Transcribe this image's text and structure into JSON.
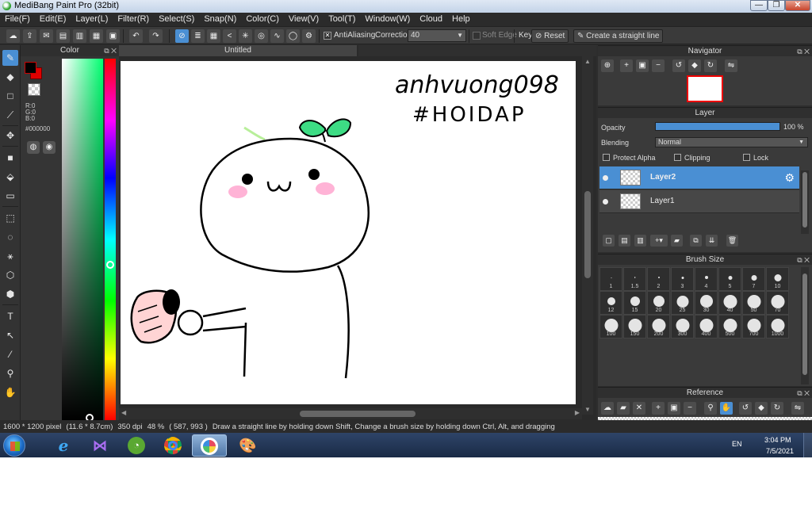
{
  "window": {
    "title": "MediBang Paint Pro (32bit)",
    "minimize_glyph": "—",
    "maximize_glyph": "❐",
    "close_glyph": "✕"
  },
  "menu": [
    "File(F)",
    "Edit(E)",
    "Layer(L)",
    "Filter(R)",
    "Select(S)",
    "Snap(N)",
    "Color(C)",
    "View(V)",
    "Tool(T)",
    "Window(W)",
    "Cloud",
    "Help"
  ],
  "toolbar": {
    "antialiasing_label": "AntiAliasing",
    "correction_label": "Correction",
    "correction_value": "40",
    "soft_edge_label": "Soft Edge",
    "key_label": "Key",
    "reset_label": "Reset",
    "straight_line_label": "Create a straight line",
    "antialiasing_checked": true,
    "soft_edge_checked": false
  },
  "color_panel": {
    "title": "Color",
    "r": "R:0",
    "g": "G:0",
    "b": "B:0",
    "hex": "#000000",
    "foreground_color": "#000000",
    "background_color": "#e00000"
  },
  "document": {
    "tab_title": "Untitled",
    "handwriting_line1": "anhvuong098",
    "handwriting_line2": "#HOIDAP"
  },
  "navigator": {
    "title": "Navigator"
  },
  "layer_panel": {
    "title": "Layer",
    "opacity_label": "Opacity",
    "opacity_value": "100 %",
    "opacity_percent": 100,
    "blending_label": "Blending",
    "blending_value": "Normal",
    "protect_alpha_label": "Protect Alpha",
    "clipping_label": "Clipping",
    "lock_label": "Lock",
    "layers": [
      {
        "name": "Layer2",
        "selected": true
      },
      {
        "name": "Layer1",
        "selected": false
      }
    ]
  },
  "brush_panel": {
    "title": "Brush Size",
    "sizes": [
      "1",
      "1.5",
      "2",
      "3",
      "4",
      "5",
      "7",
      "10",
      "12",
      "15",
      "20",
      "25",
      "30",
      "40",
      "50",
      "70",
      "100",
      "150",
      "200",
      "300",
      "400",
      "500",
      "700",
      "1000"
    ]
  },
  "reference_panel": {
    "title": "Reference"
  },
  "status": {
    "pixel_size": "1600 * 1200 pixel",
    "cm_size": "(11.6 * 8.7cm)",
    "dpi": "350 dpi",
    "zoom": "48 %",
    "cursor": "( 587, 993 )",
    "hint": "Draw a straight line by holding down Shift, Change a brush size by holding down Ctrl, Alt, and dragging"
  },
  "taskbar": {
    "language": "EN",
    "time": "3:04 PM",
    "date": "7/5/2021"
  },
  "colors": {
    "accent": "#4a8fd3",
    "panel_bg": "#3a3a3a",
    "sprout_green": "#3ddc84",
    "blush_pink": "#ffb3d6"
  }
}
